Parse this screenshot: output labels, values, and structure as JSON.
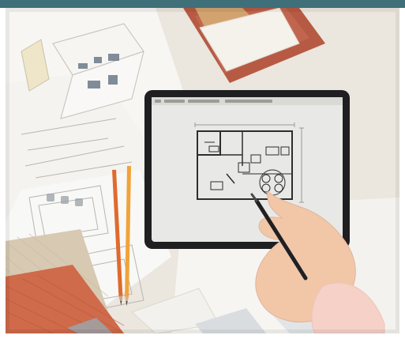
{
  "frame": {
    "accent": "#3f6f79",
    "background": "#ffffff"
  },
  "scene": {
    "subject": "architect-tablet-with-floor-plan",
    "palette": {
      "paper": "#f6f5f2",
      "desk": "#e6e0d6",
      "brick": "#b75a44",
      "wood": "#d2a36f",
      "tablet_frame": "#1f1f22",
      "tablet_screen": "#e8e8e6",
      "pencil_orange": "#e06a2d",
      "pencil_yellow": "#f0a33a",
      "hand": "#f1c7a8",
      "sleeve": "#f5d1c7",
      "fabric_beige": "#d7c9b2",
      "fabric_terracotta": "#cf6a4a"
    }
  }
}
